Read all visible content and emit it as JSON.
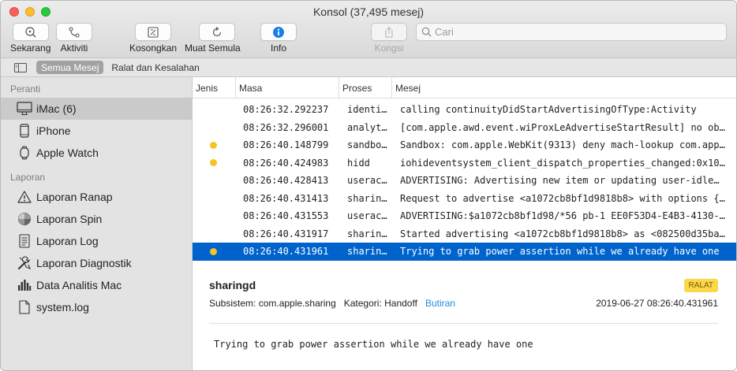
{
  "window": {
    "title": "Konsol (37,495 mesej)"
  },
  "toolbar": {
    "now_label": "Sekarang",
    "activity_label": "Aktiviti",
    "clear_label": "Kosongkan",
    "reload_label": "Muat Semula",
    "info_label": "Info",
    "share_label": "Kongsi",
    "search_placeholder": "Cari"
  },
  "scopebar": {
    "all_messages": "Semua Mesej",
    "errors_faults": "Ralat dan Kesalahan"
  },
  "sidebar": {
    "devices_header": "Peranti",
    "devices": [
      {
        "label": "iMac (6)",
        "icon": "imac-icon",
        "selected": true
      },
      {
        "label": "iPhone",
        "icon": "iphone-icon"
      },
      {
        "label": "Apple Watch",
        "icon": "apple-watch-icon"
      }
    ],
    "reports_header": "Laporan",
    "reports": [
      {
        "label": "Laporan Ranap",
        "icon": "warning-icon"
      },
      {
        "label": "Laporan Spin",
        "icon": "spin-icon"
      },
      {
        "label": "Laporan Log",
        "icon": "log-icon"
      },
      {
        "label": "Laporan Diagnostik",
        "icon": "tools-icon"
      },
      {
        "label": "Data Analitis Mac",
        "icon": "analytics-icon"
      },
      {
        "label": "system.log",
        "icon": "document-icon"
      }
    ]
  },
  "table": {
    "columns": [
      "Jenis",
      "Masa",
      "Proses",
      "Mesej"
    ],
    "rows": [
      {
        "dot": false,
        "time": "08:26:32.292237",
        "process": "identi…",
        "message": "calling continuityDidStartAdvertisingOfType:Activity"
      },
      {
        "dot": false,
        "time": "08:26:32.296001",
        "process": "analyt…",
        "message": "[com.apple.awd.event.wiProxLeAdvertiseStartResult] no ob…"
      },
      {
        "dot": true,
        "time": "08:26:40.148799",
        "process": "sandbo…",
        "message": "Sandbox: com.apple.WebKit(9313) deny mach-lookup com.app…"
      },
      {
        "dot": true,
        "time": "08:26:40.424983",
        "process": "hidd",
        "message": "iohideventsystem_client_dispatch_properties_changed:0x10…"
      },
      {
        "dot": false,
        "time": "08:26:40.428413",
        "process": "userac…",
        "message": "ADVERTISING: Advertising new item or updating user-idle…"
      },
      {
        "dot": false,
        "time": "08:26:40.431413",
        "process": "sharin…",
        "message": "Request to advertise <a1072cb8bf1d9818b8> with options {…"
      },
      {
        "dot": false,
        "time": "08:26:40.431553",
        "process": "userac…",
        "message": "ADVERTISING:$a1072cb8bf1d98/*56 pb-1 EE0F53D4-E4B3-4130-…"
      },
      {
        "dot": false,
        "time": "08:26:40.431917",
        "process": "sharin…",
        "message": "Started advertising <a1072cb8bf1d9818b8> as <082500d35ba…"
      },
      {
        "dot": true,
        "time": "08:26:40.431961",
        "process": "sharin…",
        "message": "Trying to grab power assertion while we already have one",
        "selected": true
      }
    ]
  },
  "detail": {
    "process": "sharingd",
    "badge": "RALAT",
    "subsystem": "Subsistem: com.apple.sharing",
    "category": "Kategori: Handoff",
    "details_link": "Butiran",
    "timestamp": "2019-06-27 08:26:40.431961",
    "message": "Trying to grab power assertion while we already have one"
  },
  "colors": {
    "selection": "#0063cc",
    "warning_dot": "#f5c424",
    "badge": "#fbd84a",
    "link": "#1a8fe0",
    "info_button": "#1a7fe8"
  }
}
